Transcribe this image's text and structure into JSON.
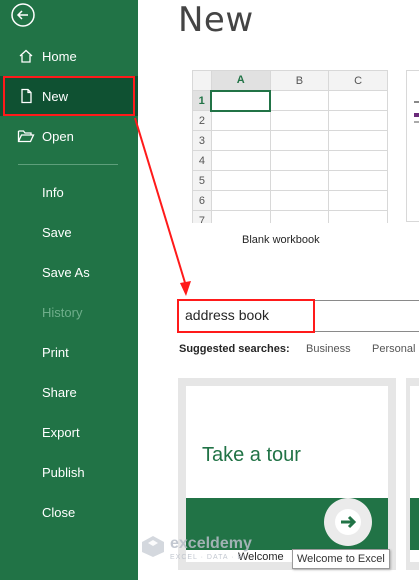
{
  "sidebar": {
    "back_icon": "back-arrow-icon",
    "items": [
      {
        "label": "Home",
        "icon": "home-icon"
      },
      {
        "label": "New",
        "icon": "new-document-icon"
      },
      {
        "label": "Open",
        "icon": "folder-open-icon"
      },
      {
        "label": "Info"
      },
      {
        "label": "Save"
      },
      {
        "label": "Save As"
      },
      {
        "label": "History"
      },
      {
        "label": "Print"
      },
      {
        "label": "Share"
      },
      {
        "label": "Export"
      },
      {
        "label": "Publish"
      },
      {
        "label": "Close"
      }
    ],
    "selected": "New",
    "disabled": "History"
  },
  "main": {
    "title": "New",
    "blank_workbook": {
      "label": "Blank workbook",
      "columns": [
        "A",
        "B",
        "C"
      ],
      "rows": [
        "1",
        "2",
        "3",
        "4",
        "5",
        "6",
        "7"
      ]
    },
    "search": {
      "value": "address book"
    },
    "suggested": {
      "label": "Suggested searches:",
      "links": [
        "Business",
        "Personal"
      ]
    },
    "tour_card": {
      "title": "Take a tour",
      "caption": "Welcome",
      "tooltip": "Welcome to Excel"
    }
  },
  "watermark": {
    "name": "exceldemy",
    "tagline": "EXCEL · DATA · BI"
  },
  "colors": {
    "brand_green": "#217346",
    "selected_green": "#0f5132",
    "highlight_red": "#ff1a1a"
  }
}
